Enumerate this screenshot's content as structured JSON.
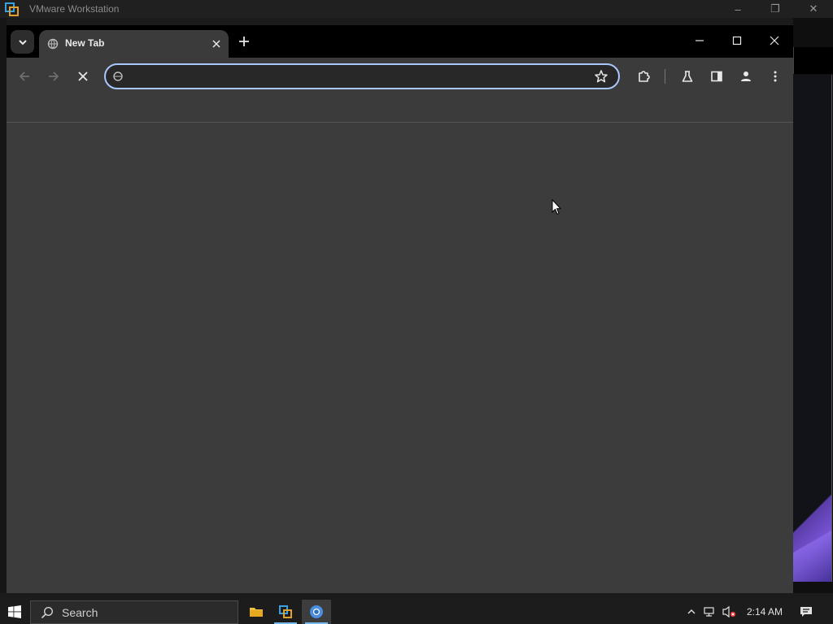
{
  "vmware": {
    "title": "VMware Workstation",
    "minimize_label": "–",
    "restore_label": "❐",
    "close_label": "✕"
  },
  "browser": {
    "tab": {
      "title": "New Tab"
    },
    "omnibox": {
      "value": "",
      "placeholder": ""
    },
    "loading": true,
    "accent_color": "#a8c7fa",
    "theme": "dark"
  },
  "taskbar": {
    "search_placeholder": "Search",
    "clock": "2:14 AM",
    "pinned_apps": [
      "file-explorer",
      "vmware-workstation",
      "chrome"
    ],
    "active_app": "chrome"
  }
}
